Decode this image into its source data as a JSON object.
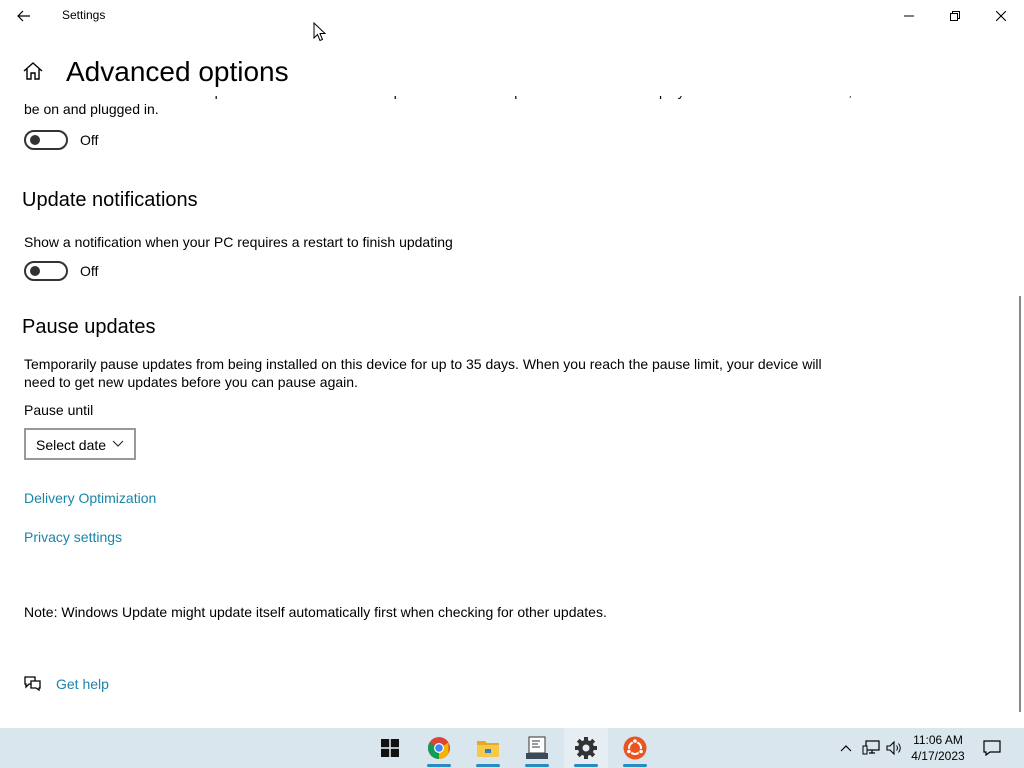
{
  "window": {
    "title": "Settings",
    "icons": {
      "back": "back-arrow-icon",
      "minimize": "minimize-icon",
      "maximize": "restore-icon",
      "close": "close-icon"
    }
  },
  "page": {
    "title": "Advanced options",
    "home_icon": "home-icon"
  },
  "restart_setting": {
    "description": "Restart this device as soon as possible when a restart is required to install an update. Windows will display a notice before the restart, and the device must be on and plugged in.",
    "state": "Off"
  },
  "update_notifications": {
    "heading": "Update notifications",
    "description": "Show a notification when your PC requires a restart to finish updating",
    "state": "Off"
  },
  "pause_updates": {
    "heading": "Pause updates",
    "description": "Temporarily pause updates from being installed on this device for up to 35 days. When you reach the pause limit, your device will need to get new updates before you can pause again.",
    "pause_until_label": "Pause until",
    "select_value": "Select date"
  },
  "links": {
    "delivery_optimization": "Delivery Optimization",
    "privacy_settings": "Privacy settings",
    "get_help": "Get help"
  },
  "note": "Note: Windows Update might update itself automatically first when checking for other updates.",
  "taskbar": {
    "apps": [
      "start-icon",
      "chrome-icon",
      "file-explorer-icon",
      "terminal-icon",
      "settings-icon",
      "ubuntu-icon"
    ],
    "active_app": "settings-icon",
    "clock": {
      "time": "11:06 AM",
      "date": "4/17/2023"
    },
    "tray_icons": [
      "chevron-up-icon",
      "network-icon",
      "volume-icon",
      "notification-icon"
    ]
  },
  "colors": {
    "link": "#1a85a8",
    "taskbar": "#d9e6ee",
    "accent_underline": "#2b8ac0"
  }
}
